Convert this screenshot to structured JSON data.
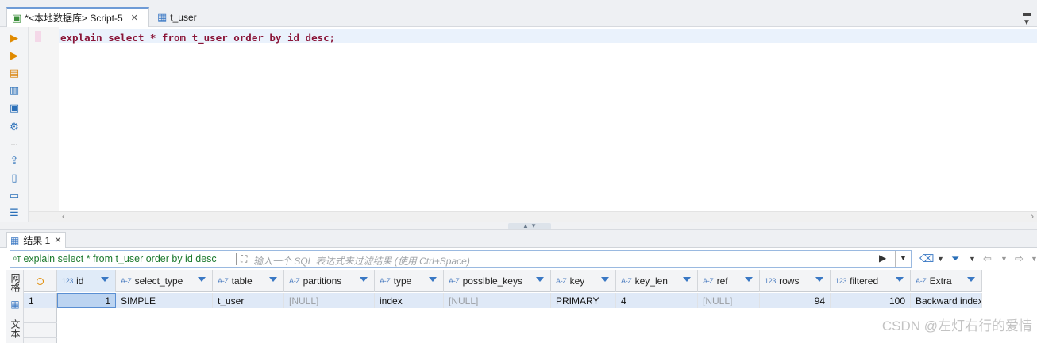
{
  "tabs": [
    {
      "label": "*<本地数据库> Script-5",
      "active": true
    },
    {
      "label": "t_user",
      "active": false
    }
  ],
  "editor": {
    "code": "explain select * from t_user order by id desc;"
  },
  "results": {
    "tab_label": "结果 1",
    "filter_sql": "explain select * from t_user order by id desc",
    "filter_placeholder": "输入一个 SQL 表达式来过滤结果 (使用 Ctrl+Space)",
    "side_tabs": [
      "网格",
      "文本"
    ],
    "columns": [
      {
        "type": "123",
        "name": "id"
      },
      {
        "type": "A-Z",
        "name": "select_type"
      },
      {
        "type": "A-Z",
        "name": "table"
      },
      {
        "type": "A-Z",
        "name": "partitions"
      },
      {
        "type": "A-Z",
        "name": "type"
      },
      {
        "type": "A-Z",
        "name": "possible_keys"
      },
      {
        "type": "A-Z",
        "name": "key"
      },
      {
        "type": "A-Z",
        "name": "key_len"
      },
      {
        "type": "A-Z",
        "name": "ref"
      },
      {
        "type": "123",
        "name": "rows"
      },
      {
        "type": "123",
        "name": "filtered"
      },
      {
        "type": "A-Z",
        "name": "Extra"
      }
    ],
    "rows": [
      {
        "num": "1",
        "cells": [
          "1",
          "SIMPLE",
          "t_user",
          "[NULL]",
          "index",
          "[NULL]",
          "PRIMARY",
          "4",
          "[NULL]",
          "94",
          "100",
          "Backward index"
        ]
      }
    ]
  },
  "watermark": "CSDN @左灯右行的爱情",
  "colors": {
    "accent": "#3a78c4",
    "keyword": "#8a1538",
    "filter_green": "#1d7a2e",
    "selected_row": "#dfe9f7"
  }
}
